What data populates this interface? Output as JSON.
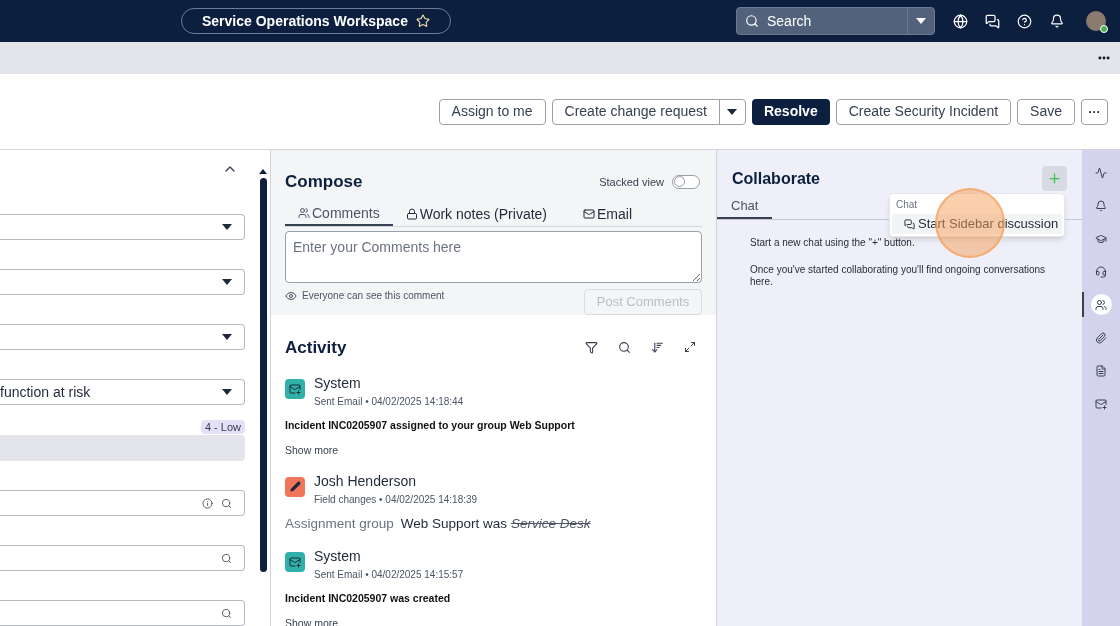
{
  "header": {
    "title": "Service Operations Workspace",
    "favorite": false,
    "search": {
      "placeholder": "Search"
    }
  },
  "actions": [
    {
      "label": "Assign to me",
      "kind": "plain"
    },
    {
      "label": "Create change request",
      "kind": "split"
    },
    {
      "label": "Resolve",
      "kind": "primary"
    },
    {
      "label": "Create Security Incident",
      "kind": "plain"
    },
    {
      "label": "Save",
      "kind": "plain"
    },
    {
      "label": "···",
      "kind": "more"
    }
  ],
  "form": {
    "expanded": true,
    "fields": [
      {
        "kind": "select"
      },
      {
        "kind": "select"
      },
      {
        "kind": "select"
      },
      {
        "kind": "select",
        "value": "function at risk"
      },
      {
        "kind": "readonly",
        "badge": "4 - Low"
      },
      {
        "kind": "lookup",
        "info": true
      },
      {
        "kind": "lookup",
        "info": false
      },
      {
        "kind": "lookup",
        "info": false
      }
    ]
  },
  "compose": {
    "title": "Compose",
    "stacked_view": {
      "label": "Stacked view",
      "on": false
    },
    "tabs": [
      {
        "label": "Comments",
        "kind": "people",
        "selected": true
      },
      {
        "label": "Work notes (Private)",
        "kind": "lock",
        "selected": false
      },
      {
        "label": "Email",
        "kind": "mail",
        "selected": false
      }
    ],
    "placeholder": "Enter your Comments here",
    "visibility": "Everyone can see this comment",
    "post": {
      "label": "Post Comments",
      "disabled": true
    }
  },
  "activity": {
    "title": "Activity",
    "entries": [
      {
        "kind": "email",
        "author": "System",
        "type": "Sent Email",
        "sep": "•",
        "time": "04/02/2025 14:18:44",
        "text": "Incident INC0205907 assigned to your group Web Support",
        "more": "Show more"
      },
      {
        "kind": "field_change",
        "author": "Josh Henderson",
        "type": "Field changes",
        "sep": "•",
        "time": "04/02/2025 14:18:39",
        "field": "Assignment group",
        "new_value": "Web Support was",
        "old_value": "Service Desk"
      },
      {
        "kind": "email",
        "author": "System",
        "type": "Sent Email",
        "sep": "•",
        "time": "04/02/2025 14:15:57",
        "text": "Incident INC0205907 was created",
        "more": "Show more"
      }
    ]
  },
  "collaborate": {
    "title": "Collaborate",
    "tabs": [
      {
        "label": "Chat",
        "selected": true
      }
    ],
    "menu": {
      "heading": "Chat",
      "items": [
        "Start Sidebar discussion"
      ]
    },
    "messages": [
      "Start a new chat using the \"+\" button.",
      "Once you've started collaborating you'll find ongoing conversations here."
    ]
  },
  "rail": [
    {
      "kind": "activity",
      "selected": false
    },
    {
      "kind": "bell",
      "selected": false
    },
    {
      "kind": "cap",
      "selected": false
    },
    {
      "kind": "headset",
      "selected": false
    },
    {
      "kind": "people",
      "selected": true
    },
    {
      "kind": "clip",
      "selected": false
    },
    {
      "kind": "doc",
      "selected": false
    },
    {
      "kind": "mail",
      "selected": false
    }
  ]
}
